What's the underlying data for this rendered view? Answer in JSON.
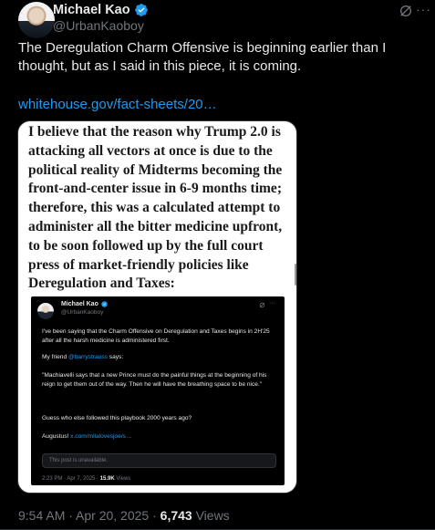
{
  "author": {
    "name": "Michael Kao",
    "handle": "@UrbanKaoboy",
    "verified": true,
    "avatar_icon": "avatar"
  },
  "actions": {
    "grok_icon": "grok-icon",
    "more_icon": "more-icon"
  },
  "tweet": {
    "text": "The Deregulation Charm Offensive is beginning earlier than I thought, but as I said in this piece, it is coming.",
    "link_text": "whitehouse.gov/fact-sheets/20…"
  },
  "media": {
    "quote": "I believe that the reason why Trump 2.0 is attacking all vectors at once is due to the political reality of Midterms becoming the front-and-center issue in 6-9 months time; therefore, this was a calculated attempt to administer all the bitter medicine upfront, to be soon followed up by the full court press of market-friendly policies like Deregulation and Taxes:",
    "embedded": {
      "name": "Michael Kao",
      "handle": "@UrbanKaoboy",
      "para1": "I've been saying that the Charm Offensive on Deregulation and Taxes begins in 2H'25 after all the harsh medicine is administered first.",
      "para2_prefix": "My friend ",
      "para2_mention": "@barrystrauss",
      "para2_suffix": " says:",
      "para3": "\"Machiavelli says that a new Prince must do the painful things at the beginning of his reign to get them out of the way. Then he will have the breathing space to be nice.\"",
      "para4": "Guess who else followed this playbook 2000 years ago?",
      "para5_prefix": "Augustus! ",
      "para5_link": "x.com/milalovesjoe/s…",
      "unavailable": "This post is unavailable.",
      "time": "2:23 PM · Apr 7, 2025 · ",
      "views_count": "15.9K",
      "views_label": " Views"
    }
  },
  "meta": {
    "time": "9:54 AM · Apr 20, 2025 · ",
    "views_count": "6,743",
    "views_label": " Views"
  },
  "colors": {
    "background": "#000000",
    "text": "#e7e9ea",
    "secondary": "#71767b",
    "link": "#1d9bf0"
  }
}
